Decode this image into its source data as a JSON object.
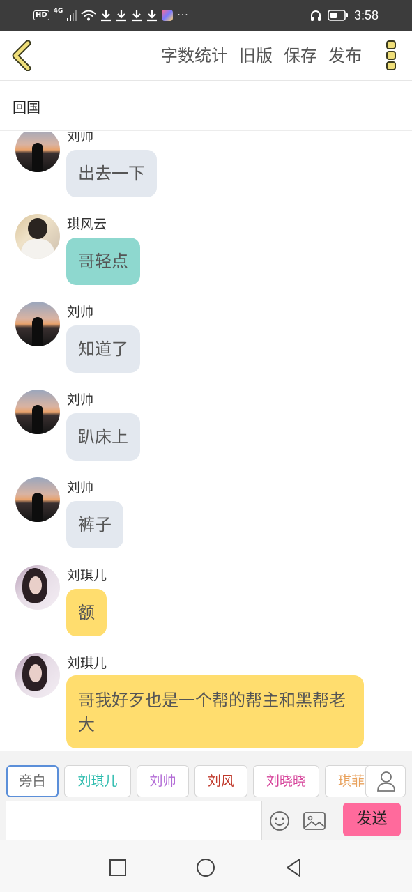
{
  "status_bar": {
    "hd": "HD",
    "network": "4G",
    "more": "···",
    "time": "3:58"
  },
  "header": {
    "actions": [
      "字数统计",
      "旧版",
      "保存",
      "发布"
    ],
    "accent_color": "#f0df7a"
  },
  "chapter": {
    "title": "回国"
  },
  "messages": [
    {
      "name": "刘帅",
      "avatar": "sunset-silhouette",
      "text": "出去一下",
      "color": "#e3e8ef"
    },
    {
      "name": "琪风云",
      "avatar": "man-portrait",
      "text": "哥轻点",
      "color": "#8ed8cf"
    },
    {
      "name": "刘帅",
      "avatar": "sunset-silhouette",
      "text": "知道了",
      "color": "#e3e8ef"
    },
    {
      "name": "刘帅",
      "avatar": "sunset-silhouette",
      "text": "趴床上",
      "color": "#e3e8ef"
    },
    {
      "name": "刘帅",
      "avatar": "sunset-silhouette",
      "text": "裤子",
      "color": "#e3e8ef"
    },
    {
      "name": "刘琪儿",
      "avatar": "woman-portrait",
      "text": "额",
      "color": "#ffdd6e"
    },
    {
      "name": "刘琪儿",
      "avatar": "woman-portrait",
      "text": "哥我好歹也是一个帮的帮主和黑帮老大",
      "color": "#ffdd6e"
    }
  ],
  "roles": [
    {
      "label": "旁白",
      "color": "#666666",
      "active": true
    },
    {
      "label": "刘琪儿",
      "color": "#2bbbad",
      "active": false
    },
    {
      "label": "刘帅",
      "color": "#b26ad6",
      "active": false
    },
    {
      "label": "刘风",
      "color": "#c0392b",
      "active": false
    },
    {
      "label": "刘晓晓",
      "color": "#d6439a",
      "active": false
    },
    {
      "label": "琪菲",
      "color": "#e8a15c",
      "active": false
    }
  ],
  "input": {
    "placeholder": "",
    "send_label": "发送",
    "send_color": "#ff6a9c"
  },
  "icons": {
    "back": "chevron-left-icon",
    "menu": "three-dots-vertical-icon",
    "user": "user-icon",
    "emoji": "smiley-icon",
    "image": "image-icon",
    "nav": [
      "square-icon",
      "circle-icon",
      "triangle-back-icon"
    ]
  }
}
